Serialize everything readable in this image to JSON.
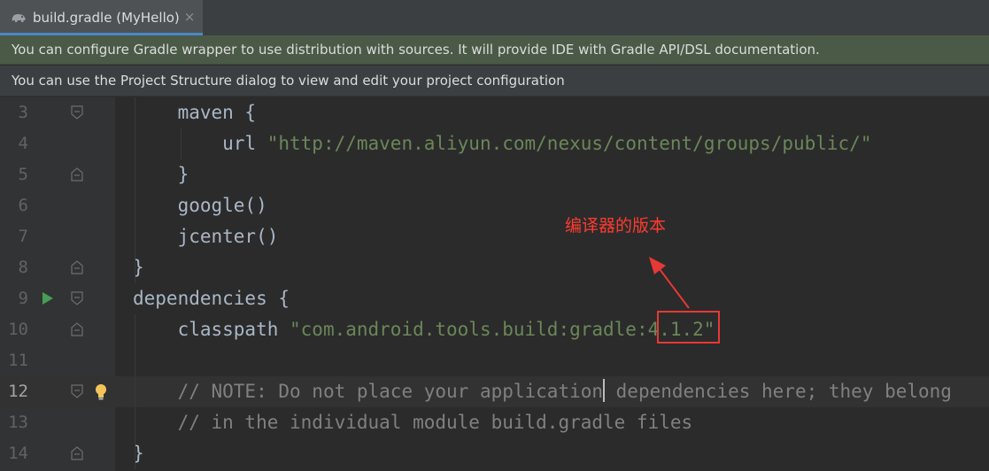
{
  "tab": {
    "label": "build.gradle (MyHello)",
    "close": "×",
    "icon": "gradle-elephant-icon"
  },
  "banners": {
    "gradle_wrapper": "You can configure Gradle wrapper to use distribution with sources. It will provide IDE with Gradle API/DSL documentation.",
    "project_structure": "You can use the Project Structure dialog to view and edit your project configuration"
  },
  "editor": {
    "current_line": 12,
    "lines": [
      {
        "num": "3",
        "indent": "        ",
        "segments": [
          {
            "text": "maven {",
            "kind": "plain"
          }
        ]
      },
      {
        "num": "4",
        "indent": "            ",
        "segments": [
          {
            "text": "url ",
            "kind": "plain"
          },
          {
            "text": "\"http://maven.aliyun.com/nexus/content/groups/public/\"",
            "kind": "string"
          }
        ]
      },
      {
        "num": "5",
        "indent": "        ",
        "segments": [
          {
            "text": "}",
            "kind": "plain"
          }
        ]
      },
      {
        "num": "6",
        "indent": "        ",
        "segments": [
          {
            "text": "google()",
            "kind": "plain"
          }
        ]
      },
      {
        "num": "7",
        "indent": "        ",
        "segments": [
          {
            "text": "jcenter()",
            "kind": "plain"
          }
        ]
      },
      {
        "num": "8",
        "indent": "    ",
        "segments": [
          {
            "text": "}",
            "kind": "plain"
          }
        ]
      },
      {
        "num": "9",
        "indent": "    ",
        "segments": [
          {
            "text": "dependencies {",
            "kind": "plain"
          }
        ]
      },
      {
        "num": "10",
        "indent": "        ",
        "segments": [
          {
            "text": "classpath ",
            "kind": "plain"
          },
          {
            "text": "\"com.android.tools.build:gradle:4.1.2\"",
            "kind": "string"
          }
        ]
      },
      {
        "num": "11",
        "indent": "",
        "segments": []
      },
      {
        "num": "12",
        "indent": "        ",
        "segments": [
          {
            "text": "// NOTE: Do not place your application",
            "kind": "comment"
          },
          {
            "text": "",
            "kind": "caret"
          },
          {
            "text": " dependencies here; they belong",
            "kind": "comment"
          }
        ]
      },
      {
        "num": "13",
        "indent": "        ",
        "segments": [
          {
            "text": "// in the individual module build.gradle files",
            "kind": "comment"
          }
        ]
      },
      {
        "num": "14",
        "indent": "    ",
        "segments": [
          {
            "text": "}",
            "kind": "plain"
          }
        ]
      }
    ]
  },
  "annotation": {
    "text": "编译器的版本",
    "highlighted_value": "4.1.2",
    "color": "#ff3b2f"
  },
  "colors": {
    "string": "#6a8759",
    "comment": "#808080",
    "plain": "#a9b7c6",
    "banner_green": "#4a5a47"
  }
}
